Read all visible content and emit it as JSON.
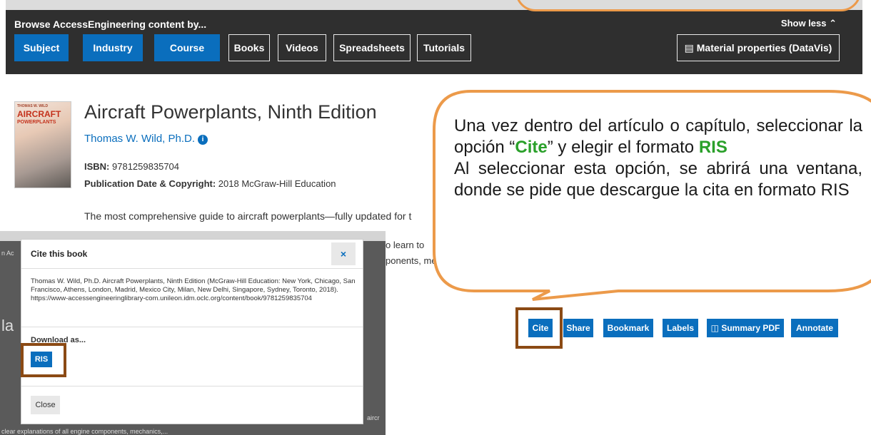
{
  "browse": {
    "title": "Browse AccessEngineering content by...",
    "show_less": "Show less ⌃",
    "chips": [
      "Subject",
      "Industry",
      "Course",
      "Books",
      "Videos",
      "Spreadsheets",
      "Tutorials"
    ],
    "material_properties": "Material properties (DataVis)"
  },
  "book": {
    "cover_top": "THOMAS W. WILD",
    "cover_title_1": "AIRCRAFT",
    "cover_title_2": "POWERPLANTS",
    "title": "Aircraft Powerplants, Ninth Edition",
    "author": "Thomas W. Wild, Ph.D.",
    "isbn_label": "ISBN:",
    "isbn": "9781259835704",
    "pubdate_label": "Publication Date & Copyright:",
    "pubdate": "2018 McGraw-Hill Education",
    "description": "The most comprehensive guide to aircraft powerplants—fully updated for t",
    "desc_fragment_1": "o learn to",
    "desc_fragment_2": "ponents, me"
  },
  "inset": {
    "left_text_1": "n Ac",
    "left_text_2": "la",
    "bottom_text": "clear explanations of all engine components, mechanics,...",
    "right_text": "aircr"
  },
  "modal": {
    "title": "Cite this book",
    "close_x": "×",
    "citation": "Thomas W. Wild, Ph.D. Aircraft Powerplants, Ninth Edition (McGraw-Hill Education: New York, Chicago, San Francisco, Athens, London, Madrid, Mexico City, Milan, New Delhi, Singapore, Sydney, Toronto, 2018). https://www-accessengineeringlibrary-com.unileon.idm.oclc.org/content/book/9781259835704",
    "download_as": "Download as...",
    "ris": "RIS",
    "close": "Close"
  },
  "actions": [
    "Cite",
    "Share",
    "Bookmark",
    "Labels",
    "Summary PDF",
    "Annotate"
  ],
  "callout": {
    "line_a": "Una vez dentro del artículo o capítulo, seleccionar la opción “",
    "cite_word": "Cite",
    "line_b": "” y elegir el formato ",
    "ris_word": "RIS",
    "line_c": "Al seleccionar esta opción, se abrirá una ventana, donde se pide que descargue la cita en formato RIS"
  },
  "colors": {
    "accent_blue": "#0a6ebd",
    "dark_bar": "#2f2f2f",
    "callout_border": "#ec9a4a",
    "highlight_box": "#8b4a14",
    "green_text": "#2aa02a"
  }
}
